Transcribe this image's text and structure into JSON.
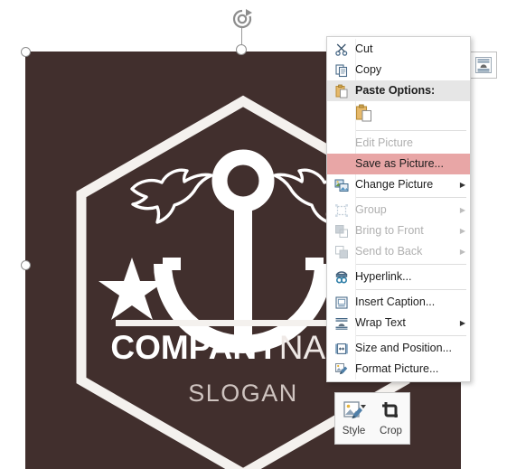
{
  "app": {
    "context": "word-picture-context-menu"
  },
  "picture": {
    "alt_name": "company-logo-picture",
    "background_color": "#412F2D",
    "logo": {
      "company_bold": "COMPANY",
      "company_light": "NAME",
      "slogan": "SLOGAN",
      "elements": [
        "hexagon-outline",
        "dove-left",
        "dove-right",
        "anchor",
        "star",
        "divider-line"
      ]
    }
  },
  "selection": {
    "rotate_handle": "rotate-handle",
    "handles": [
      "top-left",
      "middle-left"
    ]
  },
  "layout_options": {
    "tooltip": "Layout Options",
    "icon": "layout-options-icon"
  },
  "mini_toolbar": {
    "buttons": [
      {
        "label": "Style",
        "icon": "picture-style-icon",
        "has_dropdown": true
      },
      {
        "label": "Crop",
        "icon": "crop-icon",
        "has_dropdown": false
      }
    ]
  },
  "context_menu": {
    "items": [
      {
        "label": "Cut",
        "icon": "scissors-icon",
        "state": "enabled",
        "submenu": false,
        "separator_after": false,
        "accel": "t"
      },
      {
        "label": "Copy",
        "icon": "copy-icon",
        "state": "enabled",
        "submenu": false,
        "separator_after": false,
        "accel": "C"
      },
      {
        "label": "Paste Options:",
        "icon": "paste-icon",
        "state": "header",
        "submenu": false,
        "separator_after": false,
        "accel": ""
      },
      {
        "label": "Edit Picture",
        "icon": "none",
        "state": "disabled",
        "submenu": false,
        "separator_after": false,
        "accel": "E"
      },
      {
        "label": "Save as Picture...",
        "icon": "none",
        "state": "highlight",
        "submenu": false,
        "separator_after": false,
        "accel": "S"
      },
      {
        "label": "Change Picture",
        "icon": "change-picture-icon",
        "state": "enabled",
        "submenu": true,
        "separator_after": true,
        "accel": "g"
      },
      {
        "label": "Group",
        "icon": "group-icon",
        "state": "disabled",
        "submenu": true,
        "separator_after": false,
        "accel": "G"
      },
      {
        "label": "Bring to Front",
        "icon": "bring-front-icon",
        "state": "disabled",
        "submenu": true,
        "separator_after": false,
        "accel": "F"
      },
      {
        "label": "Send to Back",
        "icon": "send-back-icon",
        "state": "disabled",
        "submenu": true,
        "separator_after": true,
        "accel": "k"
      },
      {
        "label": "Hyperlink...",
        "icon": "hyperlink-icon",
        "state": "enabled",
        "submenu": false,
        "separator_after": true,
        "accel": "i"
      },
      {
        "label": "Insert Caption...",
        "icon": "insert-caption-icon",
        "state": "enabled",
        "submenu": false,
        "separator_after": false,
        "accel": "n"
      },
      {
        "label": "Wrap Text",
        "icon": "wrap-text-icon",
        "state": "enabled",
        "submenu": true,
        "separator_after": true,
        "accel": "W"
      },
      {
        "label": "Size and Position...",
        "icon": "size-position-icon",
        "state": "enabled",
        "submenu": false,
        "separator_after": false,
        "accel": "z"
      },
      {
        "label": "Format Picture...",
        "icon": "format-picture-icon",
        "state": "enabled",
        "submenu": false,
        "separator_after": false,
        "accel": "o"
      }
    ],
    "paste_option_icon": "paste-keep-source-formatting-icon",
    "highlight_color": "#E8A6A6",
    "header_background": "#E6E6E6"
  }
}
